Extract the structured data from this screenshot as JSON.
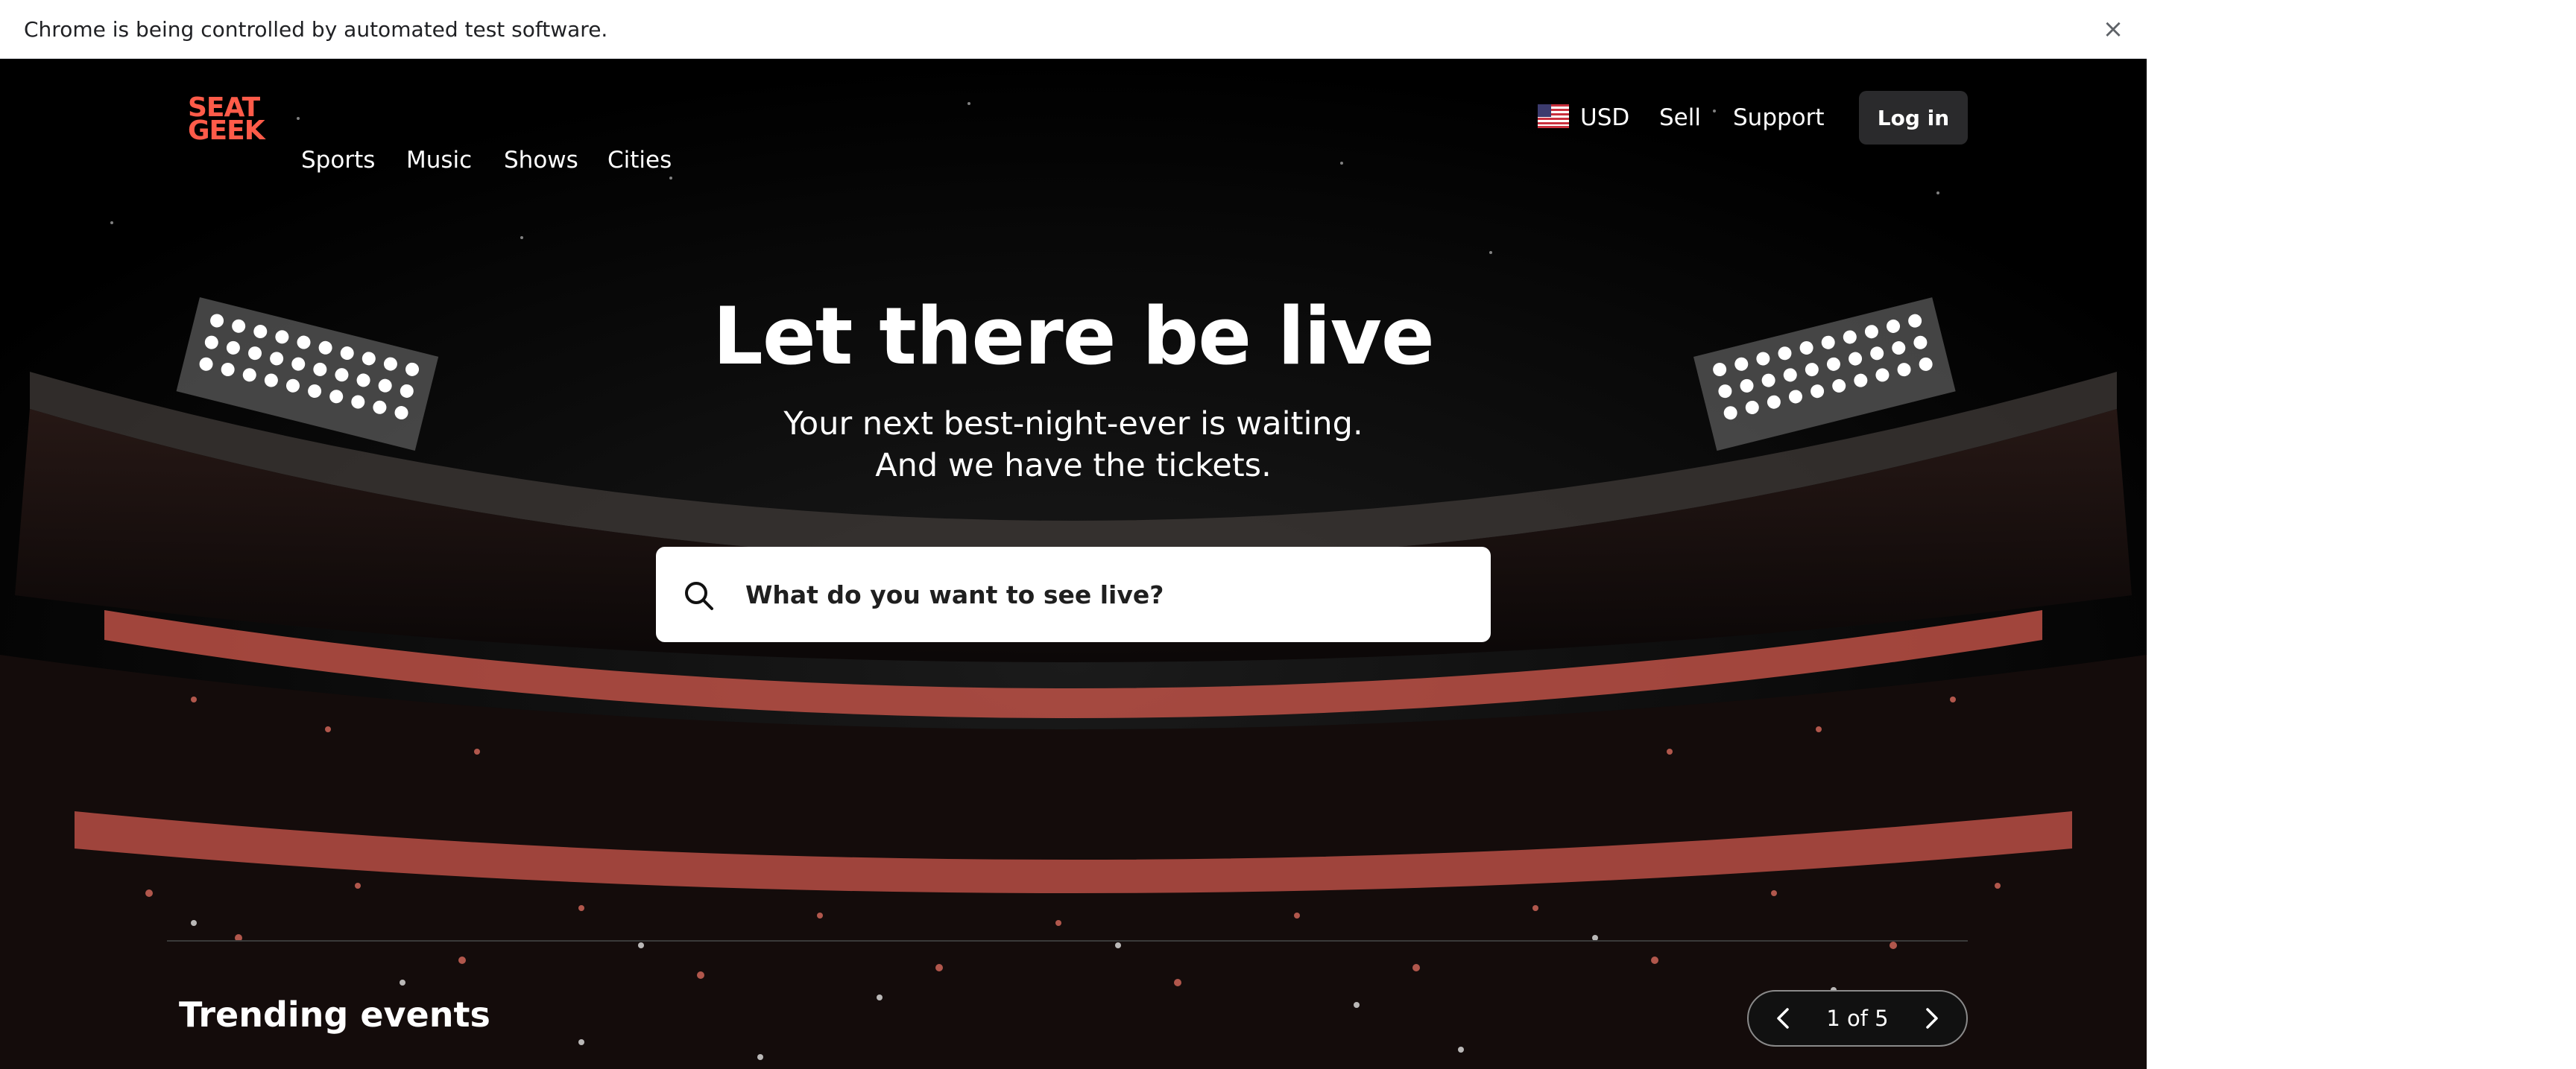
{
  "infobar": {
    "message": "Chrome is being controlled by automated test software.",
    "close_icon": "close-icon"
  },
  "header": {
    "logo_line1": "SEAT",
    "logo_line2": "GEEK",
    "nav": [
      "Sports",
      "Music",
      "Shows",
      "Cities"
    ],
    "currency": "USD",
    "sell": "Sell",
    "support": "Support",
    "login": "Log in"
  },
  "hero": {
    "title": "Let there be live",
    "subtitle_line1": "Your next best-night-ever is waiting.",
    "subtitle_line2": "And we have the tickets."
  },
  "search": {
    "placeholder": "What do you want to see live?",
    "icon": "search-icon"
  },
  "trending": {
    "heading": "Trending events",
    "pager_label": "1 of 5",
    "prev_icon": "chevron-left-icon",
    "next_icon": "chevron-right-icon"
  },
  "colors": {
    "brand": "#ff5b49",
    "background": "#000000",
    "button": "#2a2a2c"
  }
}
